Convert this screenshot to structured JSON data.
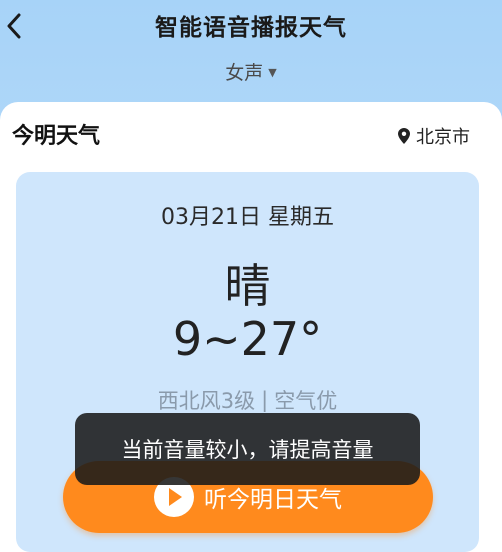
{
  "header": {
    "title": "智能语音播报天气",
    "voice": "女声"
  },
  "section": {
    "title": "今明天气",
    "location": "北京市"
  },
  "weather": {
    "date": "03月21日 星期五",
    "condition": "晴",
    "temperature": "9~27°",
    "wind": "西北风3级",
    "separator": "|",
    "air": "空气优"
  },
  "listen_button": {
    "label": "听今明日天气"
  },
  "toast": {
    "message": "当前音量较小，请提高音量"
  },
  "colors": {
    "accent": "#ff8a1d",
    "card": "#cfe6fc",
    "header_bg": "#a7d3f8"
  },
  "icons": {
    "back": "chevron-left-icon",
    "dropdown": "caret-down-icon",
    "location": "location-pin-icon",
    "play": "play-icon"
  }
}
